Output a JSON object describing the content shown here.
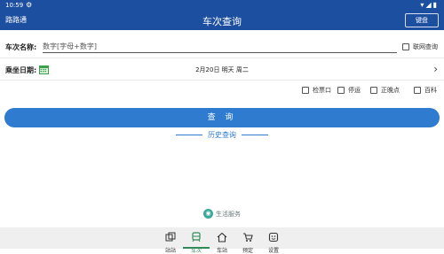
{
  "status_bar": {
    "time": "10:59"
  },
  "app_bar": {
    "brand": "路路通",
    "title": "车次查询",
    "keyboard_label": "键盘"
  },
  "train_row": {
    "label": "车次名称:",
    "placeholder": "数字[字母+数字]",
    "online_label": "联网查询"
  },
  "date_row": {
    "label": "乘坐日期:",
    "date_text": "2月20日 明天 周二"
  },
  "options": [
    {
      "label": "检票口",
      "checked": false
    },
    {
      "label": "停运",
      "checked": false
    },
    {
      "label": "正晚点",
      "checked": false
    },
    {
      "label": "百科",
      "checked": false
    }
  ],
  "search_label": "查 询",
  "history_label": "历史查询",
  "life_service_label": "生活服务",
  "bottom_nav": [
    {
      "label": "站站",
      "icon": "station-to-station-icon"
    },
    {
      "label": "车次",
      "icon": "train-icon",
      "active": true
    },
    {
      "label": "车站",
      "icon": "home-station-icon"
    },
    {
      "label": "预定",
      "icon": "cart-icon"
    },
    {
      "label": "设置",
      "icon": "settings-icon"
    }
  ],
  "colors": {
    "primary": "#1d4fa0",
    "button": "#2f7bd0",
    "active_tab": "#2e8b57"
  }
}
